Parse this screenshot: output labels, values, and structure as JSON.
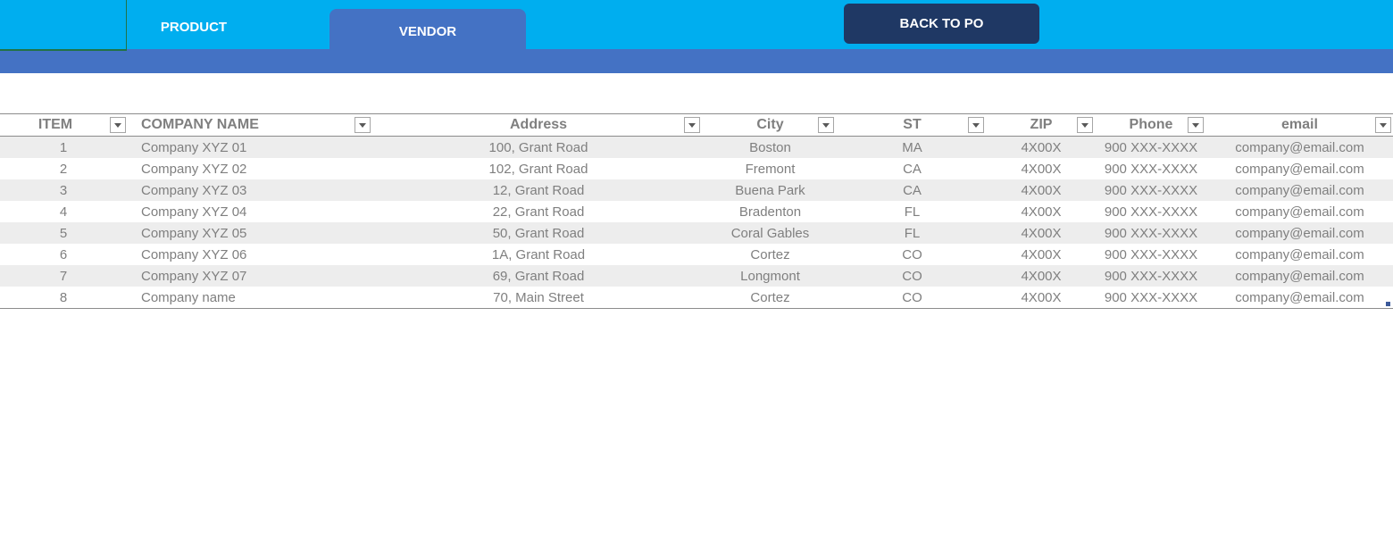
{
  "tabs": {
    "product_label": "PRODUCT",
    "vendor_label": "VENDOR",
    "back_label": "BACK TO PO"
  },
  "table": {
    "headers": [
      "ITEM",
      "COMPANY NAME",
      "Address",
      "City",
      "ST",
      "ZIP",
      "Phone",
      "email"
    ],
    "rows": [
      [
        "1",
        "Company XYZ 01",
        "100, Grant Road",
        "Boston",
        "MA",
        "4X00X",
        "900 XXX-XXXX",
        "company@email.com"
      ],
      [
        "2",
        "Company XYZ 02",
        "102, Grant Road",
        "Fremont",
        "CA",
        "4X00X",
        "900 XXX-XXXX",
        "company@email.com"
      ],
      [
        "3",
        "Company XYZ 03",
        "12, Grant Road",
        "Buena Park",
        "CA",
        "4X00X",
        "900 XXX-XXXX",
        "company@email.com"
      ],
      [
        "4",
        "Company XYZ 04",
        "22, Grant Road",
        "Bradenton",
        "FL",
        "4X00X",
        "900 XXX-XXXX",
        "company@email.com"
      ],
      [
        "5",
        "Company XYZ 05",
        "50, Grant Road",
        "Coral Gables",
        "FL",
        "4X00X",
        "900 XXX-XXXX",
        "company@email.com"
      ],
      [
        "6",
        "Company XYZ 06",
        "1A, Grant Road",
        "Cortez",
        "CO",
        "4X00X",
        "900 XXX-XXXX",
        "company@email.com"
      ],
      [
        "7",
        "Company XYZ 07",
        "69, Grant Road",
        "Longmont",
        "CO",
        "4X00X",
        "900 XXX-XXXX",
        "company@email.com"
      ],
      [
        "8",
        "Company name",
        "70, Main Street",
        "Cortez",
        "CO",
        "4X00X",
        "900 XXX-XXXX",
        "company@email.com"
      ]
    ]
  },
  "icons": {
    "filter": "filter-dropdown-icon"
  },
  "colors": {
    "topbar": "#00aeef",
    "band": "#4472c4",
    "back_button": "#1f3864",
    "text": "#7f7f7f",
    "row_alt": "#ededed"
  }
}
